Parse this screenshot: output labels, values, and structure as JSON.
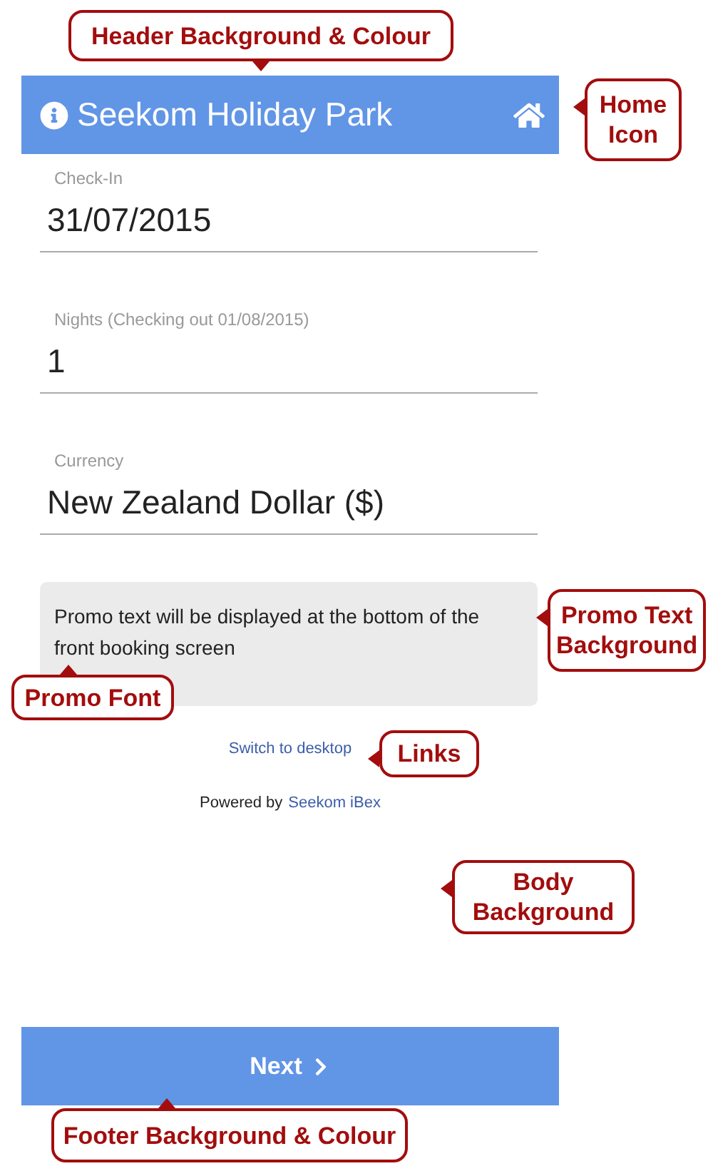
{
  "header": {
    "title": "Seekom Holiday Park"
  },
  "fields": [
    {
      "label": "Check-In",
      "value": "31/07/2015"
    },
    {
      "label": "Nights (Checking out 01/08/2015)",
      "value": "1"
    },
    {
      "label": "Currency",
      "value": "New Zealand Dollar ($)"
    }
  ],
  "promo": {
    "text": "Promo text will be displayed at the bottom of the front booking screen"
  },
  "switch_link": "Switch to desktop",
  "powered_by": {
    "prefix": "Powered by",
    "link": "Seekom iBex"
  },
  "next_button": {
    "label": "Next"
  },
  "annotations": [
    {
      "text": "Header Background & Colour",
      "kind": "down"
    },
    {
      "text": "Home Icon",
      "kind": "left"
    },
    {
      "text": "Promo Text Background",
      "kind": "left"
    },
    {
      "text": "Promo Font",
      "kind": "up"
    },
    {
      "text": "Links",
      "kind": "left"
    },
    {
      "text": "Body Background",
      "kind": "left"
    },
    {
      "text": "Footer Background & Colour",
      "kind": "up"
    }
  ]
}
